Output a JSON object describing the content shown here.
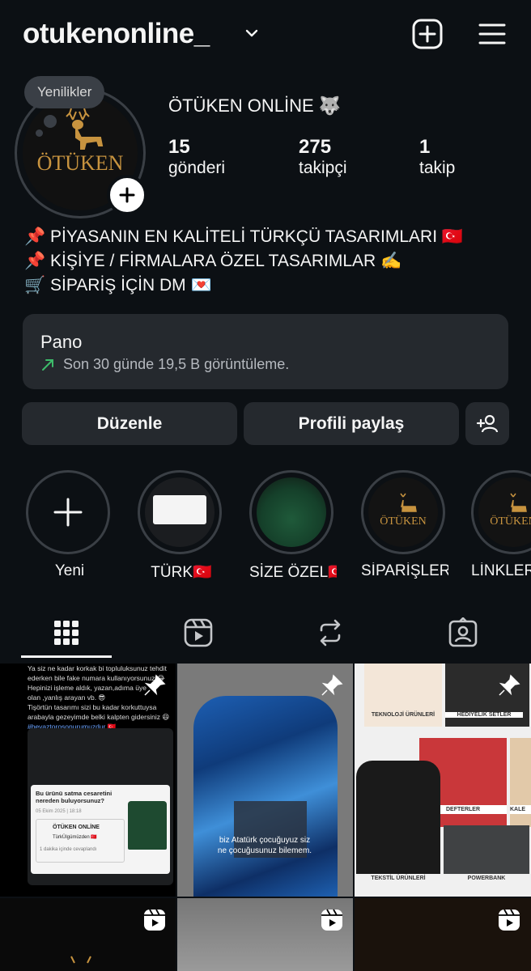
{
  "header": {
    "username": "otukenonline_",
    "new_post_icon": "plus-square-icon",
    "menu_icon": "hamburger-menu-icon"
  },
  "profile": {
    "note": "Yenilikler",
    "display_name": "ÖTÜKEN ONLİNE 🐺",
    "avatar_text": "ÖTÜKEN",
    "stats": [
      {
        "value": "15",
        "label": "gönderi"
      },
      {
        "value": "275",
        "label": "takipçi"
      },
      {
        "value": "1",
        "label": "takip"
      }
    ],
    "bio": [
      "📌 PİYASANIN EN KALİTELİ TÜRKÇÜ TASARIMLARI 🇹🇷",
      "📌 KİŞİYE / FİRMALARA ÖZEL TASARIMLAR ✍️",
      "🛒 SİPARİŞ İÇİN DM 💌"
    ]
  },
  "dashboard": {
    "title": "Pano",
    "subtitle": "Son 30 günde 19,5 B görüntüleme.",
    "trend_color": "#3dbb6a"
  },
  "actions": {
    "edit": "Düzenle",
    "share": "Profili paylaş"
  },
  "highlights": [
    {
      "label": "Yeni"
    },
    {
      "label": "TÜRK🇹🇷"
    },
    {
      "label": "SİZE ÖZEL🇹🇷"
    },
    {
      "label": "SİPARİŞLER..."
    },
    {
      "label": "LİNKLER"
    }
  ],
  "tabs": [
    "grid-icon",
    "reels-icon",
    "reposts-icon",
    "tagged-icon"
  ],
  "posts": {
    "post1": {
      "text_lines": [
        "Ya siz ne kadar korkak bi topluluksunuz tehdit",
        "ederken bile fake numara kullanıyorsunuz 😂",
        "Hepinizi işleme aldık, yazan,adıma üye",
        "olan ,yanlış arayan vb. 😎",
        "Tişörtün tasarımı sizi bu kadar korkuttuysa",
        "arabayla gezeyimde belki kalpten gidersiniz 😆",
        "#beyaztorosonurumuzdur 🇹🇷"
      ],
      "card_title": "Bu ürünü satma cesaretini nereden buluyorsunuz?",
      "card_stars": "**** ****",
      "card_date": "05 Ekim 2025 | 18:18",
      "card_name": "ÖTÜKEN ONLİNE",
      "card_sub": "TürkÜlgümüzden 🇹🇷",
      "card_reply": "1 dakika içinde cevaplandı"
    },
    "post2": {
      "caption": "biz Atatürk çocuğuyuz siz ne çocuğusunuz bilemem."
    },
    "post3": {
      "labels": [
        "TEKNOLOJİ ÜRÜNLERİ",
        "HEDİYELİK SETLER",
        "DEFTERLER",
        "KALE",
        "TEKSTİL ÜRÜNLERİ",
        "POWERBANK"
      ]
    }
  }
}
